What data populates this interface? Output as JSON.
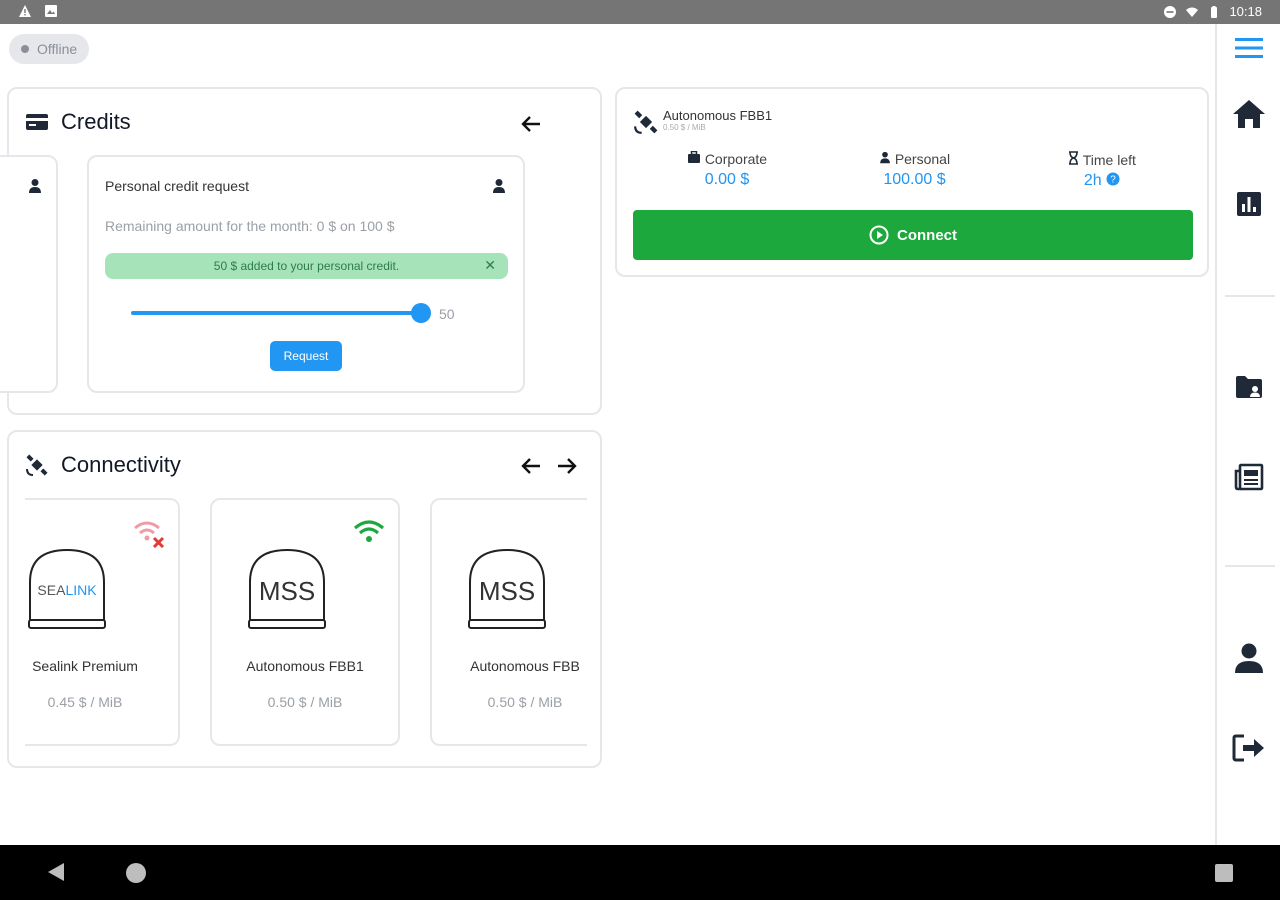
{
  "status_bar": {
    "time": "10:18"
  },
  "offline_badge": "Offline",
  "credits": {
    "title": "Credits",
    "request_card": {
      "title": "Personal credit request",
      "remaining": "Remaining amount for the month: 0 $ on 100 $",
      "alert": "50 $ added to your personal credit.",
      "slider_value": "50",
      "slider_fraction": 0.97,
      "request_label": "Request"
    }
  },
  "connectivity": {
    "title": "Connectivity",
    "providers": [
      {
        "logo_a": "SEA",
        "logo_b": "LINK",
        "name": "Sealink Premium",
        "price": "0.45 $ / MiB",
        "status": "disconnected"
      },
      {
        "logo_a": "MSS",
        "logo_b": "",
        "name": "Autonomous FBB1",
        "price": "0.50 $ / MiB",
        "status": "connected"
      },
      {
        "logo_a": "MSS",
        "logo_b": "",
        "name": "Autonomous FBB",
        "price": "0.50 $ / MiB",
        "status": "disconnected"
      }
    ]
  },
  "connection": {
    "name": "Autonomous FBB1",
    "rate": "0.50 $ / MiB",
    "corporate_label": "Corporate",
    "corporate_value": "0.00 $",
    "personal_label": "Personal",
    "personal_value": "100.00 $",
    "time_left_label": "Time left",
    "time_left_value": "2h",
    "connect_label": "Connect"
  },
  "sidebar": {
    "items": [
      "menu-icon",
      "home-icon",
      "chart-icon",
      "folder-user-icon",
      "newspaper-icon",
      "user-icon",
      "logout-icon"
    ]
  },
  "colors": {
    "accent": "#2196f3",
    "success": "#1ca83d",
    "danger": "#e53935"
  }
}
